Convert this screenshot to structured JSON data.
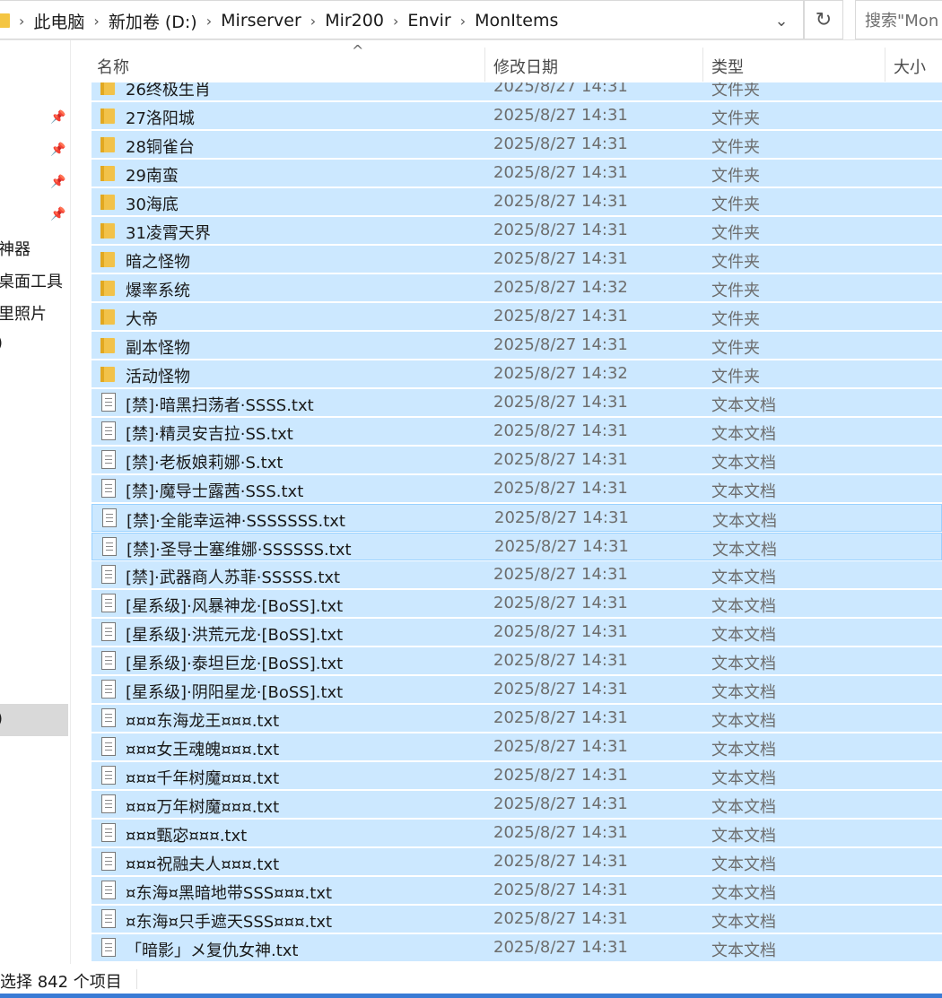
{
  "address": {
    "crumbs": [
      "此电脑",
      "新加卷 (D:)",
      "Mirserver",
      "Mir200",
      "Envir",
      "MonItems"
    ],
    "separator": "›",
    "dropdown_icon": "chevron-down-icon",
    "refresh_icon": "refresh-icon",
    "search_placeholder": "搜索\"Mon"
  },
  "nav": {
    "items": [
      "神器",
      "桌面工具",
      "里照片",
      ")",
      ")"
    ]
  },
  "columns": {
    "name": "名称",
    "date": "修改日期",
    "type": "类型",
    "size": "大小"
  },
  "files": [
    {
      "name": "26终极生肖",
      "date": "2025/8/27 14:31",
      "type": "文件夹",
      "kind": "folder"
    },
    {
      "name": "27洛阳城",
      "date": "2025/8/27 14:31",
      "type": "文件夹",
      "kind": "folder"
    },
    {
      "name": "28铜雀台",
      "date": "2025/8/27 14:31",
      "type": "文件夹",
      "kind": "folder"
    },
    {
      "name": "29南蛮",
      "date": "2025/8/27 14:31",
      "type": "文件夹",
      "kind": "folder"
    },
    {
      "name": "30海底",
      "date": "2025/8/27 14:31",
      "type": "文件夹",
      "kind": "folder"
    },
    {
      "name": "31凌霄天界",
      "date": "2025/8/27 14:31",
      "type": "文件夹",
      "kind": "folder"
    },
    {
      "name": "暗之怪物",
      "date": "2025/8/27 14:31",
      "type": "文件夹",
      "kind": "folder"
    },
    {
      "name": "爆率系统",
      "date": "2025/8/27 14:32",
      "type": "文件夹",
      "kind": "folder"
    },
    {
      "name": "大帝",
      "date": "2025/8/27 14:31",
      "type": "文件夹",
      "kind": "folder"
    },
    {
      "name": "副本怪物",
      "date": "2025/8/27 14:31",
      "type": "文件夹",
      "kind": "folder"
    },
    {
      "name": "活动怪物",
      "date": "2025/8/27 14:32",
      "type": "文件夹",
      "kind": "folder"
    },
    {
      "name": "[禁]·暗黑扫荡者·SSSS.txt",
      "date": "2025/8/27 14:31",
      "type": "文本文档",
      "kind": "doc"
    },
    {
      "name": "[禁]·精灵安吉拉·SS.txt",
      "date": "2025/8/27 14:31",
      "type": "文本文档",
      "kind": "doc"
    },
    {
      "name": "[禁]·老板娘莉娜·S.txt",
      "date": "2025/8/27 14:31",
      "type": "文本文档",
      "kind": "doc"
    },
    {
      "name": "[禁]·魔导士露茜·SSS.txt",
      "date": "2025/8/27 14:31",
      "type": "文本文档",
      "kind": "doc"
    },
    {
      "name": "[禁]·全能幸运神·SSSSSSS.txt",
      "date": "2025/8/27 14:31",
      "type": "文本文档",
      "kind": "doc"
    },
    {
      "name": "[禁]·圣导士塞维娜·SSSSSS.txt",
      "date": "2025/8/27 14:31",
      "type": "文本文档",
      "kind": "doc"
    },
    {
      "name": "[禁]·武器商人苏菲·SSSSS.txt",
      "date": "2025/8/27 14:31",
      "type": "文本文档",
      "kind": "doc"
    },
    {
      "name": "[星系级]·风暴神龙·[BoSS].txt",
      "date": "2025/8/27 14:31",
      "type": "文本文档",
      "kind": "doc"
    },
    {
      "name": "[星系级]·洪荒元龙·[BoSS].txt",
      "date": "2025/8/27 14:31",
      "type": "文本文档",
      "kind": "doc"
    },
    {
      "name": "[星系级]·泰坦巨龙·[BoSS].txt",
      "date": "2025/8/27 14:31",
      "type": "文本文档",
      "kind": "doc"
    },
    {
      "name": "[星系级]·阴阳星龙·[BoSS].txt",
      "date": "2025/8/27 14:31",
      "type": "文本文档",
      "kind": "doc"
    },
    {
      "name": "¤¤¤东海龙王¤¤¤.txt",
      "date": "2025/8/27 14:31",
      "type": "文本文档",
      "kind": "doc"
    },
    {
      "name": "¤¤¤女王魂魄¤¤¤.txt",
      "date": "2025/8/27 14:31",
      "type": "文本文档",
      "kind": "doc"
    },
    {
      "name": "¤¤¤千年树魔¤¤¤.txt",
      "date": "2025/8/27 14:31",
      "type": "文本文档",
      "kind": "doc"
    },
    {
      "name": "¤¤¤万年树魔¤¤¤.txt",
      "date": "2025/8/27 14:31",
      "type": "文本文档",
      "kind": "doc"
    },
    {
      "name": "¤¤¤甄宓¤¤¤.txt",
      "date": "2025/8/27 14:31",
      "type": "文本文档",
      "kind": "doc"
    },
    {
      "name": "¤¤¤祝融夫人¤¤¤.txt",
      "date": "2025/8/27 14:31",
      "type": "文本文档",
      "kind": "doc"
    },
    {
      "name": "¤东海¤黑暗地带SSS¤¤¤.txt",
      "date": "2025/8/27 14:31",
      "type": "文本文档",
      "kind": "doc"
    },
    {
      "name": "¤东海¤只手遮天SSS¤¤¤.txt",
      "date": "2025/8/27 14:31",
      "type": "文本文档",
      "kind": "doc"
    },
    {
      "name": "「暗影」メ复仇女神.txt",
      "date": "2025/8/27 14:31",
      "type": "文本文档",
      "kind": "doc"
    }
  ],
  "status": {
    "text": "选择 842 个项目"
  },
  "colors": {
    "selection": "#cce8ff",
    "focus_border": "#99d1ff",
    "folder": "#f2c249"
  }
}
